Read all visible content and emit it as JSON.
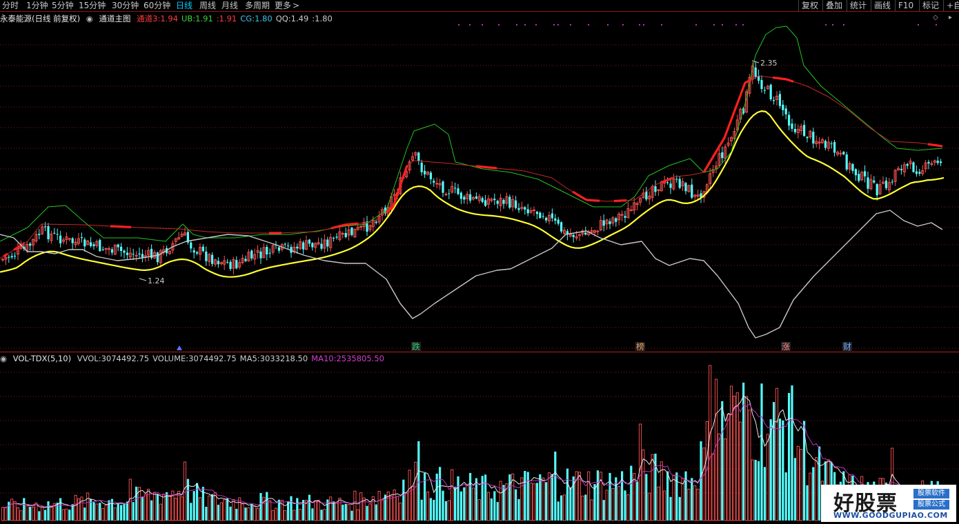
{
  "timeframe_tabs": [
    {
      "label": "分时",
      "active": false
    },
    {
      "label": "1分钟",
      "active": false
    },
    {
      "label": "5分钟",
      "active": false
    },
    {
      "label": "15分钟",
      "active": false
    },
    {
      "label": "30分钟",
      "active": false
    },
    {
      "label": "60分钟",
      "active": false
    },
    {
      "label": "日线",
      "active": true
    },
    {
      "label": "周线",
      "active": false
    },
    {
      "label": "月线",
      "active": false
    },
    {
      "label": "多周期",
      "active": false
    },
    {
      "label": "更多",
      "active": false
    }
  ],
  "toolbar_right": [
    "复权",
    "叠加",
    "统计",
    "画线",
    "F10",
    "标记",
    "+自"
  ],
  "main_panel": {
    "stock_title": "永泰能源(日线 前复权)",
    "indicator_name": "通道主图",
    "readouts": [
      {
        "label": "通道3:",
        "value": "1.94",
        "color": "#ff3b3b"
      },
      {
        "label": "UB:",
        "value": "1.91",
        "color": "#3cd43c"
      },
      {
        "label": ":",
        "value": "1.91",
        "color": "#ff3b3b"
      },
      {
        "label": "CG:",
        "value": "1.80",
        "color": "#3fc3e6"
      },
      {
        "label": "QQ:",
        "value": "1.49",
        "color": "#cccccc"
      },
      {
        "label": ":",
        "value": "1.80",
        "color": "#cccccc"
      }
    ],
    "high_label": "2.35",
    "low_label": "1.24",
    "event_markers": [
      "跌",
      "榜",
      "涨",
      "财"
    ]
  },
  "volume_panel": {
    "indicator": "VOL-TDX(5,10)",
    "readouts": [
      {
        "label": "VVOL:",
        "value": "3074492.75",
        "color": "#cccccc"
      },
      {
        "label": "VOLUME:",
        "value": "3074492.75",
        "color": "#cccccc"
      },
      {
        "label": "MA5:",
        "value": "3033218.50",
        "color": "#cccccc"
      },
      {
        "label": "MA10:",
        "value": "2535805.50",
        "color": "#d040d0"
      }
    ]
  },
  "watermark": {
    "brand": "好股票",
    "tag1": "股票软件",
    "tag2": "股票公式",
    "url": "WWW.GOODGUPIAO.COM"
  },
  "colors": {
    "up": "#ff5555",
    "down": "#54fcfc",
    "ma_yellow": "#ffff33",
    "upper_green": "#22c422",
    "mid_red": "#c82828",
    "gray_line": "#c8c8c8",
    "ma10_purple": "#c030c0",
    "grid": "#8a1a1a"
  },
  "chart_data": [
    {
      "type": "candlestick",
      "title": "永泰能源(日线 前复权)",
      "price_range": [
        1.05,
        2.48
      ],
      "visible_high": 2.35,
      "visible_low": 1.24,
      "bars": 310,
      "close_last": 1.94,
      "series": [
        {
          "name": "UB"
        },
        {
          "name": "CG"
        },
        {
          "name": "QQ"
        }
      ]
    },
    {
      "type": "bar",
      "title": "VOL-TDX(5,10)",
      "last_volume": 3074492.75,
      "series": [
        {
          "name": "MA5",
          "last": 3033218.5
        },
        {
          "name": "MA10",
          "last": 2535805.5
        }
      ]
    }
  ]
}
